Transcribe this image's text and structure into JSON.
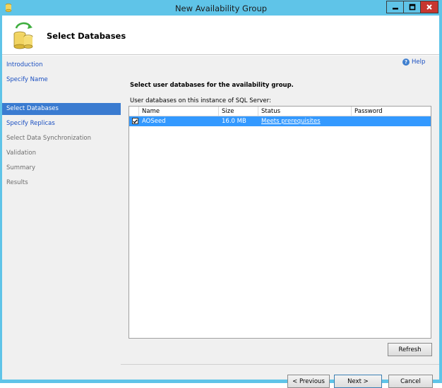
{
  "window": {
    "title": "New Availability Group",
    "controls": {
      "minimize_icon": "minimize-icon",
      "maximize_icon": "maximize-icon",
      "close_icon": "close-icon"
    }
  },
  "header": {
    "title": "Select Databases",
    "icon": "database-icon"
  },
  "sidebar": {
    "items": [
      {
        "label": "Introduction",
        "state": "link"
      },
      {
        "label": "Specify Name",
        "state": "link"
      },
      {
        "label": "Select Databases",
        "state": "active"
      },
      {
        "label": "Specify Replicas",
        "state": "link"
      },
      {
        "label": "Select Data Synchronization",
        "state": "muted"
      },
      {
        "label": "Validation",
        "state": "muted"
      },
      {
        "label": "Summary",
        "state": "muted"
      },
      {
        "label": "Results",
        "state": "muted"
      }
    ]
  },
  "main": {
    "help_label": "Help",
    "heading": "Select user databases for the availability group.",
    "grid_caption": "User databases on this instance of SQL Server:",
    "grid": {
      "columns": [
        "Name",
        "Size",
        "Status",
        "Password"
      ],
      "rows": [
        {
          "checked": true,
          "name": "AOSeed",
          "size": "16.0 MB",
          "status": "Meets prerequisites",
          "password": ""
        }
      ]
    },
    "refresh_label": "Refresh"
  },
  "footer": {
    "previous_label": "< Previous",
    "next_label": "Next >",
    "cancel_label": "Cancel"
  },
  "colors": {
    "titlebar": "#5fc4e8",
    "selection": "#3399ff",
    "nav_active": "#3a7bd0",
    "link": "#1a4fc1",
    "close_button": "#c7372f"
  }
}
